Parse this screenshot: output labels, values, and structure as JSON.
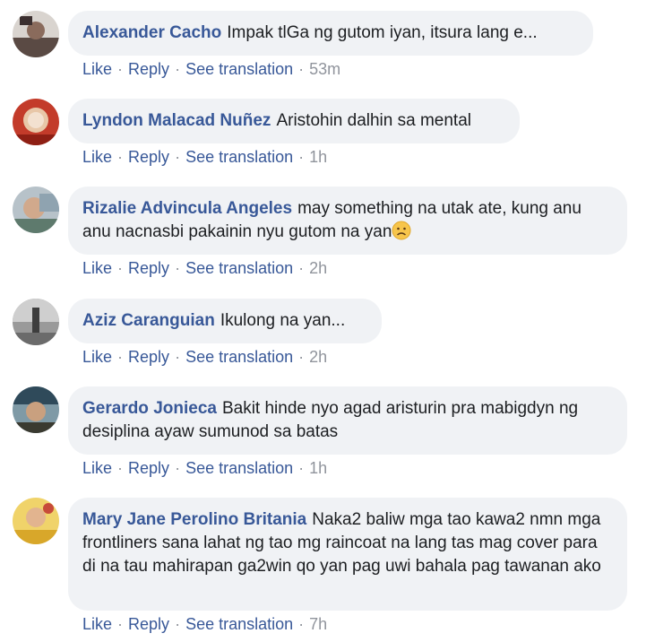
{
  "actions": {
    "like": "Like",
    "reply": "Reply",
    "see_translation": "See translation",
    "separator": "·"
  },
  "colors": {
    "author": "#385898",
    "bubble": "#f0f2f5",
    "meta": "#90949c"
  },
  "comments": [
    {
      "author": "Alexander Cacho",
      "text": "Impak tlGa ng gutom iyan, itsura lang e...",
      "time": "53m"
    },
    {
      "author": "Lyndon Malacad Nuñez",
      "text": "Aristohin dalhin sa mental",
      "time": "1h"
    },
    {
      "author": "Rizalie Advincula Angeles",
      "text": "may something na utak ate, kung anu anu nacnasbi pakainin nyu gutom na yan",
      "emoji": "sad-face-emoji",
      "time": "2h"
    },
    {
      "author": "Aziz Caranguian",
      "text": "Ikulong na yan...",
      "time": "2h"
    },
    {
      "author": "Gerardo Jonieca",
      "text": "Bakit hinde nyo agad aristurin pra mabigdyn ng desiplina ayaw sumunod sa batas",
      "time": "1h"
    },
    {
      "author": "Mary Jane Perolino Britania",
      "text": "Naka2 baliw mga tao kawa2 nmn mga frontliners sana lahat ng tao mg raincoat na lang tas mag cover para di na tau mahirapan ga2win qo yan pag uwi bahala pag tawanan ako",
      "time": "7h"
    }
  ]
}
